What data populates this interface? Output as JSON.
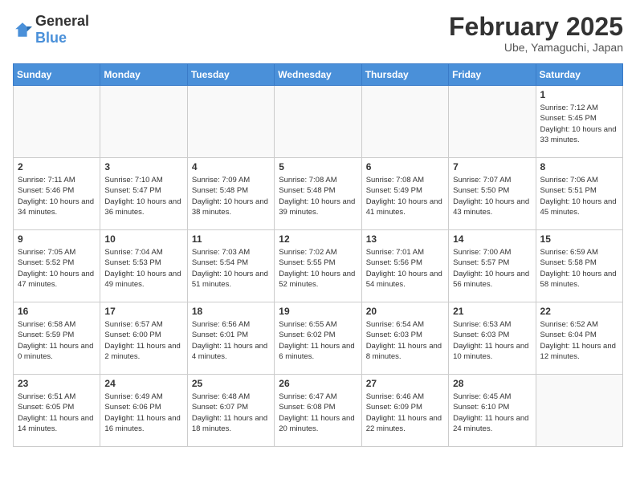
{
  "logo": {
    "general": "General",
    "blue": "Blue"
  },
  "header": {
    "month": "February 2025",
    "location": "Ube, Yamaguchi, Japan"
  },
  "weekdays": [
    "Sunday",
    "Monday",
    "Tuesday",
    "Wednesday",
    "Thursday",
    "Friday",
    "Saturday"
  ],
  "weeks": [
    [
      {
        "day": "",
        "info": ""
      },
      {
        "day": "",
        "info": ""
      },
      {
        "day": "",
        "info": ""
      },
      {
        "day": "",
        "info": ""
      },
      {
        "day": "",
        "info": ""
      },
      {
        "day": "",
        "info": ""
      },
      {
        "day": "1",
        "info": "Sunrise: 7:12 AM\nSunset: 5:45 PM\nDaylight: 10 hours\nand 33 minutes."
      }
    ],
    [
      {
        "day": "2",
        "info": "Sunrise: 7:11 AM\nSunset: 5:46 PM\nDaylight: 10 hours\nand 34 minutes."
      },
      {
        "day": "3",
        "info": "Sunrise: 7:10 AM\nSunset: 5:47 PM\nDaylight: 10 hours\nand 36 minutes."
      },
      {
        "day": "4",
        "info": "Sunrise: 7:09 AM\nSunset: 5:48 PM\nDaylight: 10 hours\nand 38 minutes."
      },
      {
        "day": "5",
        "info": "Sunrise: 7:08 AM\nSunset: 5:48 PM\nDaylight: 10 hours\nand 39 minutes."
      },
      {
        "day": "6",
        "info": "Sunrise: 7:08 AM\nSunset: 5:49 PM\nDaylight: 10 hours\nand 41 minutes."
      },
      {
        "day": "7",
        "info": "Sunrise: 7:07 AM\nSunset: 5:50 PM\nDaylight: 10 hours\nand 43 minutes."
      },
      {
        "day": "8",
        "info": "Sunrise: 7:06 AM\nSunset: 5:51 PM\nDaylight: 10 hours\nand 45 minutes."
      }
    ],
    [
      {
        "day": "9",
        "info": "Sunrise: 7:05 AM\nSunset: 5:52 PM\nDaylight: 10 hours\nand 47 minutes."
      },
      {
        "day": "10",
        "info": "Sunrise: 7:04 AM\nSunset: 5:53 PM\nDaylight: 10 hours\nand 49 minutes."
      },
      {
        "day": "11",
        "info": "Sunrise: 7:03 AM\nSunset: 5:54 PM\nDaylight: 10 hours\nand 51 minutes."
      },
      {
        "day": "12",
        "info": "Sunrise: 7:02 AM\nSunset: 5:55 PM\nDaylight: 10 hours\nand 52 minutes."
      },
      {
        "day": "13",
        "info": "Sunrise: 7:01 AM\nSunset: 5:56 PM\nDaylight: 10 hours\nand 54 minutes."
      },
      {
        "day": "14",
        "info": "Sunrise: 7:00 AM\nSunset: 5:57 PM\nDaylight: 10 hours\nand 56 minutes."
      },
      {
        "day": "15",
        "info": "Sunrise: 6:59 AM\nSunset: 5:58 PM\nDaylight: 10 hours\nand 58 minutes."
      }
    ],
    [
      {
        "day": "16",
        "info": "Sunrise: 6:58 AM\nSunset: 5:59 PM\nDaylight: 11 hours\nand 0 minutes."
      },
      {
        "day": "17",
        "info": "Sunrise: 6:57 AM\nSunset: 6:00 PM\nDaylight: 11 hours\nand 2 minutes."
      },
      {
        "day": "18",
        "info": "Sunrise: 6:56 AM\nSunset: 6:01 PM\nDaylight: 11 hours\nand 4 minutes."
      },
      {
        "day": "19",
        "info": "Sunrise: 6:55 AM\nSunset: 6:02 PM\nDaylight: 11 hours\nand 6 minutes."
      },
      {
        "day": "20",
        "info": "Sunrise: 6:54 AM\nSunset: 6:03 PM\nDaylight: 11 hours\nand 8 minutes."
      },
      {
        "day": "21",
        "info": "Sunrise: 6:53 AM\nSunset: 6:03 PM\nDaylight: 11 hours\nand 10 minutes."
      },
      {
        "day": "22",
        "info": "Sunrise: 6:52 AM\nSunset: 6:04 PM\nDaylight: 11 hours\nand 12 minutes."
      }
    ],
    [
      {
        "day": "23",
        "info": "Sunrise: 6:51 AM\nSunset: 6:05 PM\nDaylight: 11 hours\nand 14 minutes."
      },
      {
        "day": "24",
        "info": "Sunrise: 6:49 AM\nSunset: 6:06 PM\nDaylight: 11 hours\nand 16 minutes."
      },
      {
        "day": "25",
        "info": "Sunrise: 6:48 AM\nSunset: 6:07 PM\nDaylight: 11 hours\nand 18 minutes."
      },
      {
        "day": "26",
        "info": "Sunrise: 6:47 AM\nSunset: 6:08 PM\nDaylight: 11 hours\nand 20 minutes."
      },
      {
        "day": "27",
        "info": "Sunrise: 6:46 AM\nSunset: 6:09 PM\nDaylight: 11 hours\nand 22 minutes."
      },
      {
        "day": "28",
        "info": "Sunrise: 6:45 AM\nSunset: 6:10 PM\nDaylight: 11 hours\nand 24 minutes."
      },
      {
        "day": "",
        "info": ""
      }
    ]
  ]
}
